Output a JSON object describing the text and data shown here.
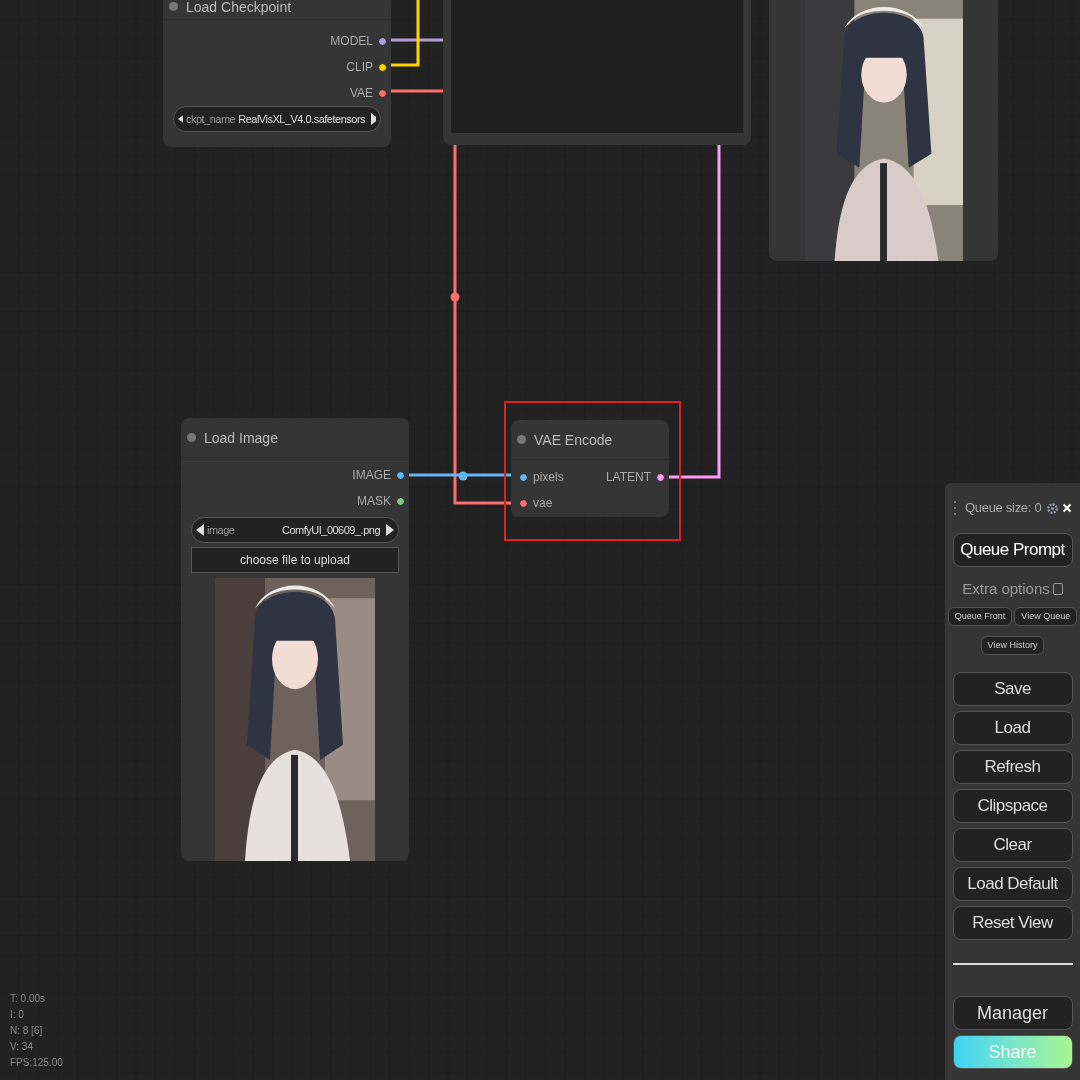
{
  "load_checkpoint": {
    "title": "Load Checkpoint",
    "outputs": [
      {
        "label": "MODEL",
        "color": "#b39ddb"
      },
      {
        "label": "CLIP",
        "color": "#ffd500"
      },
      {
        "label": "VAE",
        "color": "#ff6e6e"
      }
    ],
    "widget": {
      "name": "ckpt_name",
      "value": "RealVisXL_V4.0.safetensors"
    }
  },
  "preview_node": {
    "kind": "empty"
  },
  "load_image": {
    "title": "Load Image",
    "outputs": [
      {
        "label": "IMAGE",
        "color": "#64b5f6"
      },
      {
        "label": "MASK",
        "color": "#81c784"
      }
    ],
    "widget": {
      "name": "image",
      "value": "ComfyUI_00609_.png"
    },
    "upload_button": "choose file to upload"
  },
  "vae_encode": {
    "title": "VAE Encode",
    "highlighted": true,
    "inputs": [
      {
        "label": "pixels",
        "color": "#64b5f6"
      },
      {
        "label": "vae",
        "color": "#ff6e6e"
      }
    ],
    "outputs": [
      {
        "label": "LATENT",
        "color": "#ff9cf9"
      }
    ]
  },
  "queue_panel": {
    "title": "Queue size: 0",
    "queue_button": "Queue Prompt",
    "extra_options": {
      "label": "Extra options",
      "checked": false
    },
    "small_buttons": [
      "Queue Front",
      "View Queue",
      "View History"
    ],
    "buttons": [
      "Save",
      "Load",
      "Refresh",
      "Clipspace",
      "Clear",
      "Load Default",
      "Reset View"
    ],
    "bottom_buttons": [
      {
        "label": "Manager",
        "kind": "plain"
      },
      {
        "label": "Share",
        "kind": "gradient"
      }
    ]
  },
  "stats": [
    "T: 0.00s",
    "I: 0",
    "N: 8 [6]",
    "V: 34",
    "FPS:125.00"
  ]
}
